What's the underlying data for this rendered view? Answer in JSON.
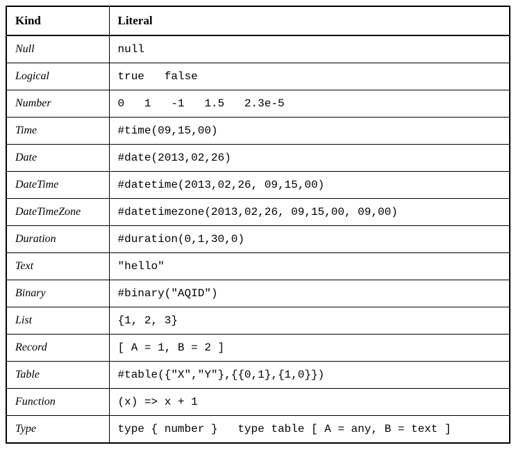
{
  "headers": {
    "kind": "Kind",
    "literal": "Literal"
  },
  "rows": [
    {
      "kind": "Null",
      "literal": "null"
    },
    {
      "kind": "Logical",
      "literal": "true   false"
    },
    {
      "kind": "Number",
      "literal": "0   1   -1   1.5   2.3e-5"
    },
    {
      "kind": "Time",
      "literal": "#time(09,15,00)"
    },
    {
      "kind": "Date",
      "literal": "#date(2013,02,26)"
    },
    {
      "kind": "DateTime",
      "literal": "#datetime(2013,02,26, 09,15,00)"
    },
    {
      "kind": "DateTimeZone",
      "literal": "#datetimezone(2013,02,26, 09,15,00, 09,00)"
    },
    {
      "kind": "Duration",
      "literal": "#duration(0,1,30,0)"
    },
    {
      "kind": "Text",
      "literal": "\"hello\""
    },
    {
      "kind": "Binary",
      "literal": "#binary(\"AQID\")"
    },
    {
      "kind": "List",
      "literal": "{1, 2, 3}"
    },
    {
      "kind": "Record",
      "literal": "[ A = 1, B = 2 ]"
    },
    {
      "kind": "Table",
      "literal": "#table({\"X\",\"Y\"},{{0,1},{1,0}})"
    },
    {
      "kind": "Function",
      "literal": "(x) => x + 1"
    },
    {
      "kind": "Type",
      "literal": "type { number }   type table [ A = any, B = text ]"
    }
  ]
}
